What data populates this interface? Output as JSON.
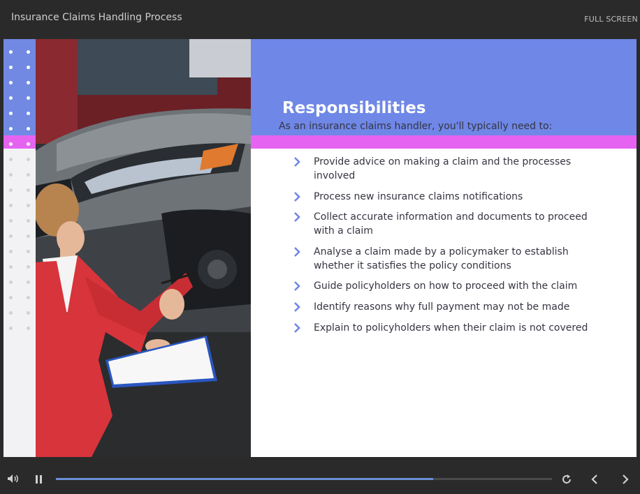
{
  "window": {
    "title": "Insurance Claims Handling Process",
    "fullscreen_label": "FULL SCREEN"
  },
  "slide": {
    "heading": "Responsibilities",
    "intro": "As an insurance claims handler, you'll typically need to:",
    "bullets": [
      "Provide advice on making a claim and the processes involved",
      "Process new insurance claims notifications",
      "Collect accurate information and documents to proceed with a claim",
      "Analyse a claim made by a policymaker to establish whether it satisfies the policy conditions",
      "Guide policyholders on how to proceed with the claim",
      "Identify reasons why full payment may not be made",
      "Explain to policyholders when their claim is not covered"
    ]
  },
  "controls": {
    "progress_fraction": 0.76,
    "icons": [
      "volume-icon",
      "pause-icon",
      "replay-icon",
      "previous-icon",
      "next-icon"
    ]
  },
  "colors": {
    "accent_blue": "#6f87e6",
    "accent_pink": "#e663f2",
    "progress": "#6a8fd6",
    "bullet_chevron": "#6f87e6"
  }
}
